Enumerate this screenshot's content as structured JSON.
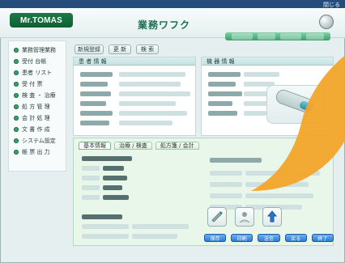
{
  "window": {
    "title_right": "閉じる"
  },
  "header": {
    "logo_text": "Mr.TOMAS",
    "title": "業務ワフク"
  },
  "sidebar": {
    "items": [
      {
        "label": "業務管理業務"
      },
      {
        "label": "受付 台帳"
      },
      {
        "label": "患者 リスト"
      },
      {
        "label": "受 付 票"
      },
      {
        "label": "検 査 ・ 治療"
      },
      {
        "label": "処 方 管 理"
      },
      {
        "label": "会 計 処 理"
      },
      {
        "label": "文 書 作 成"
      },
      {
        "label": "システム設定"
      },
      {
        "label": "帳 票 出 力"
      }
    ]
  },
  "toolbar": {
    "buttons": [
      {
        "label": "新規登録"
      },
      {
        "label": "更 新"
      },
      {
        "label": "検 索"
      }
    ]
  },
  "panels": {
    "patient": {
      "title": "患 者 情 報"
    },
    "device": {
      "title": "機 器 情 報"
    }
  },
  "lower": {
    "tabs": [
      {
        "label": "基本情報"
      },
      {
        "label": "治療 / 検査"
      },
      {
        "label": "処方箋 / 会計"
      }
    ]
  },
  "actions": {
    "buttons": [
      {
        "label": "保存"
      },
      {
        "label": "印刷"
      },
      {
        "label": "送信"
      },
      {
        "label": "戻る"
      },
      {
        "label": "終了"
      }
    ]
  },
  "colors": {
    "accent": "#3aa06a",
    "callout": "#f2a52a",
    "title_green": "#1d6e55",
    "blue_button": "#2b74c8"
  }
}
